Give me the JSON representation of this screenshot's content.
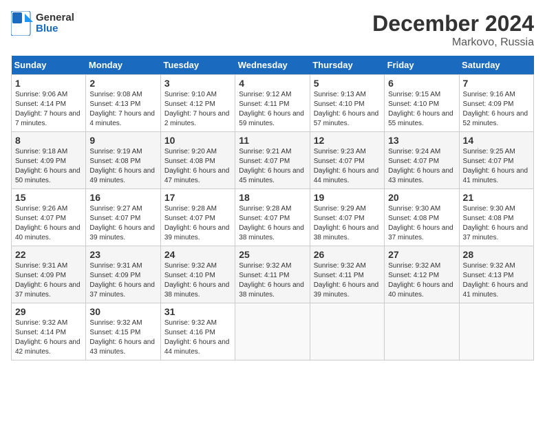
{
  "header": {
    "logo_line1": "General",
    "logo_line2": "Blue",
    "title": "December 2024",
    "subtitle": "Markovo, Russia"
  },
  "days_of_week": [
    "Sunday",
    "Monday",
    "Tuesday",
    "Wednesday",
    "Thursday",
    "Friday",
    "Saturday"
  ],
  "weeks": [
    [
      {
        "day": "1",
        "sunrise": "9:06 AM",
        "sunset": "4:14 PM",
        "daylight": "7 hours and 7 minutes."
      },
      {
        "day": "2",
        "sunrise": "9:08 AM",
        "sunset": "4:13 PM",
        "daylight": "7 hours and 4 minutes."
      },
      {
        "day": "3",
        "sunrise": "9:10 AM",
        "sunset": "4:12 PM",
        "daylight": "7 hours and 2 minutes."
      },
      {
        "day": "4",
        "sunrise": "9:12 AM",
        "sunset": "4:11 PM",
        "daylight": "6 hours and 59 minutes."
      },
      {
        "day": "5",
        "sunrise": "9:13 AM",
        "sunset": "4:10 PM",
        "daylight": "6 hours and 57 minutes."
      },
      {
        "day": "6",
        "sunrise": "9:15 AM",
        "sunset": "4:10 PM",
        "daylight": "6 hours and 55 minutes."
      },
      {
        "day": "7",
        "sunrise": "9:16 AM",
        "sunset": "4:09 PM",
        "daylight": "6 hours and 52 minutes."
      }
    ],
    [
      {
        "day": "8",
        "sunrise": "9:18 AM",
        "sunset": "4:09 PM",
        "daylight": "6 hours and 50 minutes."
      },
      {
        "day": "9",
        "sunrise": "9:19 AM",
        "sunset": "4:08 PM",
        "daylight": "6 hours and 49 minutes."
      },
      {
        "day": "10",
        "sunrise": "9:20 AM",
        "sunset": "4:08 PM",
        "daylight": "6 hours and 47 minutes."
      },
      {
        "day": "11",
        "sunrise": "9:21 AM",
        "sunset": "4:07 PM",
        "daylight": "6 hours and 45 minutes."
      },
      {
        "day": "12",
        "sunrise": "9:23 AM",
        "sunset": "4:07 PM",
        "daylight": "6 hours and 44 minutes."
      },
      {
        "day": "13",
        "sunrise": "9:24 AM",
        "sunset": "4:07 PM",
        "daylight": "6 hours and 43 minutes."
      },
      {
        "day": "14",
        "sunrise": "9:25 AM",
        "sunset": "4:07 PM",
        "daylight": "6 hours and 41 minutes."
      }
    ],
    [
      {
        "day": "15",
        "sunrise": "9:26 AM",
        "sunset": "4:07 PM",
        "daylight": "6 hours and 40 minutes."
      },
      {
        "day": "16",
        "sunrise": "9:27 AM",
        "sunset": "4:07 PM",
        "daylight": "6 hours and 39 minutes."
      },
      {
        "day": "17",
        "sunrise": "9:28 AM",
        "sunset": "4:07 PM",
        "daylight": "6 hours and 39 minutes."
      },
      {
        "day": "18",
        "sunrise": "9:28 AM",
        "sunset": "4:07 PM",
        "daylight": "6 hours and 38 minutes."
      },
      {
        "day": "19",
        "sunrise": "9:29 AM",
        "sunset": "4:07 PM",
        "daylight": "6 hours and 38 minutes."
      },
      {
        "day": "20",
        "sunrise": "9:30 AM",
        "sunset": "4:08 PM",
        "daylight": "6 hours and 37 minutes."
      },
      {
        "day": "21",
        "sunrise": "9:30 AM",
        "sunset": "4:08 PM",
        "daylight": "6 hours and 37 minutes."
      }
    ],
    [
      {
        "day": "22",
        "sunrise": "9:31 AM",
        "sunset": "4:09 PM",
        "daylight": "6 hours and 37 minutes."
      },
      {
        "day": "23",
        "sunrise": "9:31 AM",
        "sunset": "4:09 PM",
        "daylight": "6 hours and 37 minutes."
      },
      {
        "day": "24",
        "sunrise": "9:32 AM",
        "sunset": "4:10 PM",
        "daylight": "6 hours and 38 minutes."
      },
      {
        "day": "25",
        "sunrise": "9:32 AM",
        "sunset": "4:11 PM",
        "daylight": "6 hours and 38 minutes."
      },
      {
        "day": "26",
        "sunrise": "9:32 AM",
        "sunset": "4:11 PM",
        "daylight": "6 hours and 39 minutes."
      },
      {
        "day": "27",
        "sunrise": "9:32 AM",
        "sunset": "4:12 PM",
        "daylight": "6 hours and 40 minutes."
      },
      {
        "day": "28",
        "sunrise": "9:32 AM",
        "sunset": "4:13 PM",
        "daylight": "6 hours and 41 minutes."
      }
    ],
    [
      {
        "day": "29",
        "sunrise": "9:32 AM",
        "sunset": "4:14 PM",
        "daylight": "6 hours and 42 minutes."
      },
      {
        "day": "30",
        "sunrise": "9:32 AM",
        "sunset": "4:15 PM",
        "daylight": "6 hours and 43 minutes."
      },
      {
        "day": "31",
        "sunrise": "9:32 AM",
        "sunset": "4:16 PM",
        "daylight": "6 hours and 44 minutes."
      },
      null,
      null,
      null,
      null
    ]
  ]
}
